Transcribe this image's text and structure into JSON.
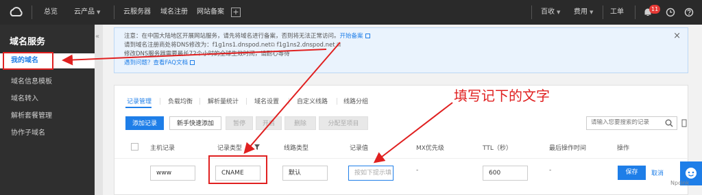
{
  "topbar": {
    "home": "总览",
    "products": "云产品",
    "servers": "云服务器",
    "domain_reg": "域名注册",
    "icp": "网站备案",
    "plus": "+",
    "baidu": "百收",
    "billing": "费用",
    "ticket": "工单",
    "notif_count": "11"
  },
  "sidebar": {
    "title": "域名服务",
    "items": [
      {
        "label": "我的域名"
      },
      {
        "label": "域名信息模板"
      },
      {
        "label": "域名转入"
      },
      {
        "label": "解析套餐管理"
      },
      {
        "label": "协作子域名"
      }
    ],
    "collapse": "«"
  },
  "notice": {
    "line1": "注意：在中国大陆地区开展网站服务，请先将域名进行备案，否则将无法正常访问。",
    "line1_link": "开始备案",
    "line2": "请到域名注册商处将DNS修改为：f1g1ns1.dnspod.net",
    "line2b": "f1g1ns2.dnspod.net",
    "line3": "修改DNS服务器需要最长72个小时的全球生效时间，请耐心等待",
    "line4": "遇到问题？查看FAQ文档",
    "close": "×"
  },
  "tabs": [
    "记录管理",
    "负载均衡",
    "解析量统计",
    "域名设置",
    "自定义线路",
    "线路分组"
  ],
  "toolbar": {
    "add": "添加记录",
    "quick_add": "新手快速添加",
    "pause": "暂停",
    "enable": "开启",
    "delete": "删除",
    "assign": "分配至项目",
    "search_placeholder": "请输入您要搜索的记录"
  },
  "table": {
    "headers": [
      "主机记录",
      "记录类型",
      "线路类型",
      "记录值",
      "MX优先级",
      "TTL（秒）",
      "最后操作时间",
      "操作"
    ],
    "row": {
      "host": "www",
      "type": "CNAME",
      "line": "默认",
      "value_placeholder": "按如下提示填",
      "mx": "-",
      "ttl": "600",
      "last_op": "-",
      "save": "保存",
      "cancel": "取消"
    }
  },
  "annotation": "填写记下的文字",
  "watermark": "Npcink",
  "colors": {
    "accent": "#1e7ee8",
    "annotation": "#e02020",
    "topbar": "#2a2a2a"
  }
}
